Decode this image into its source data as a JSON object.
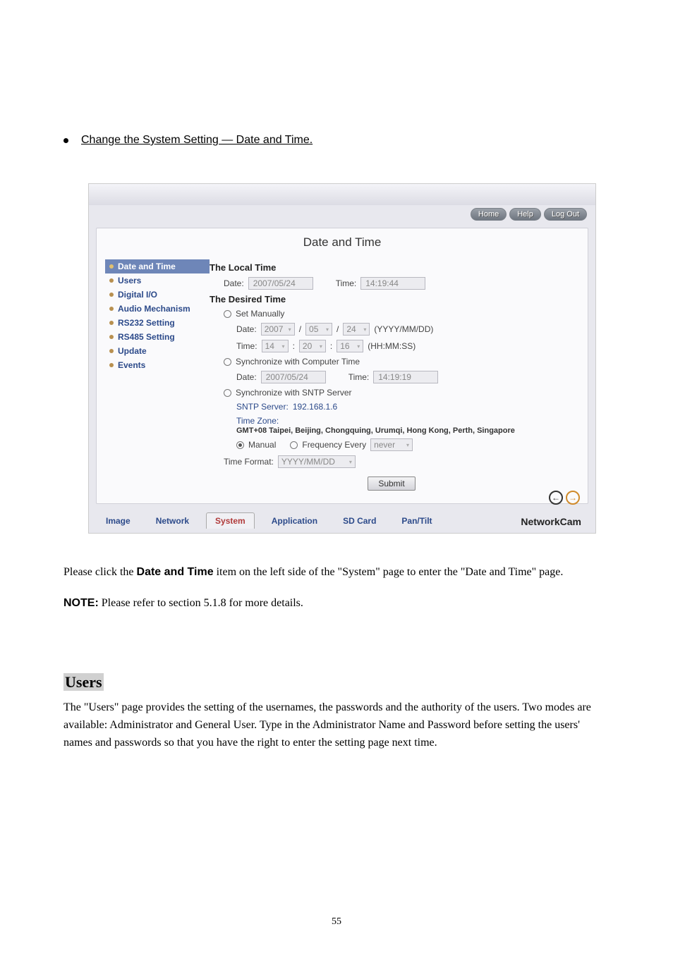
{
  "heading": "Change the System Setting — Date and Time.",
  "topButtons": {
    "home": "Home",
    "help": "Help",
    "logout": "Log Out"
  },
  "pageTitle": "Date and Time",
  "sidebar": [
    {
      "label": "Date and Time",
      "active": true
    },
    {
      "label": "Users"
    },
    {
      "label": "Digital I/O"
    },
    {
      "label": "Audio Mechanism"
    },
    {
      "label": "RS232 Setting"
    },
    {
      "label": "RS485 Setting"
    },
    {
      "label": "Update"
    },
    {
      "label": "Events"
    }
  ],
  "localTime": {
    "title": "The Local Time",
    "dateLabel": "Date:",
    "dateValue": "2007/05/24",
    "timeLabel": "Time:",
    "timeValue": "14:19:44"
  },
  "desiredTime": {
    "title": "The Desired Time",
    "setManually": "Set Manually",
    "manualDateLabel": "Date:",
    "manualYear": "2007",
    "manualMonth": "05",
    "manualDay": "24",
    "manualDateHint": "(YYYY/MM/DD)",
    "manualTimeLabel": "Time:",
    "manualHH": "14",
    "manualMM": "20",
    "manualSS": "16",
    "manualTimeHint": "(HH:MM:SS)",
    "syncComputer": "Synchronize with Computer Time",
    "compDateLabel": "Date:",
    "compDate": "2007/05/24",
    "compTimeLabel": "Time:",
    "compTime": "14:19:19",
    "syncSntp": "Synchronize with SNTP Server",
    "sntpServerLabel": "SNTP Server:",
    "sntpServerValue": "192.168.1.6",
    "timeZoneLabel": "Time Zone:",
    "timeZoneValue": "GMT+08 Taipei, Beijing, Chongquing, Urumqi, Hong Kong, Perth, Singapore",
    "sntpManual": "Manual",
    "sntpFreqLabel": "Frequency Every",
    "sntpFreqValue": "never",
    "timeFormatLabel": "Time Format:",
    "timeFormatValue": "YYYY/MM/DD"
  },
  "submit": "Submit",
  "bottomTabs": {
    "image": "Image",
    "network": "Network",
    "system": "System",
    "application": "Application",
    "sdcard": "SD Card",
    "pantilt": "Pan/Tilt"
  },
  "brand": "NetworkCam",
  "desc": {
    "p1a": "Please click the ",
    "p1bold": "Date and Time",
    "p1b": " item on the left side of the \"System\" page to enter the \"Date and Time\" page.",
    "p2label": "NOTE:",
    "p2text": " Please refer to section 5.1.8 for more details."
  },
  "usersSection": {
    "title": "Users",
    "body": "The \"Users\" page provides the setting of the usernames, the passwords and the authority of the users. Two modes are available: Administrator and General User. Type in the Administrator Name and Password before setting the users' names and passwords so that you have the right to enter the setting page next time."
  },
  "pageNumber": "55"
}
